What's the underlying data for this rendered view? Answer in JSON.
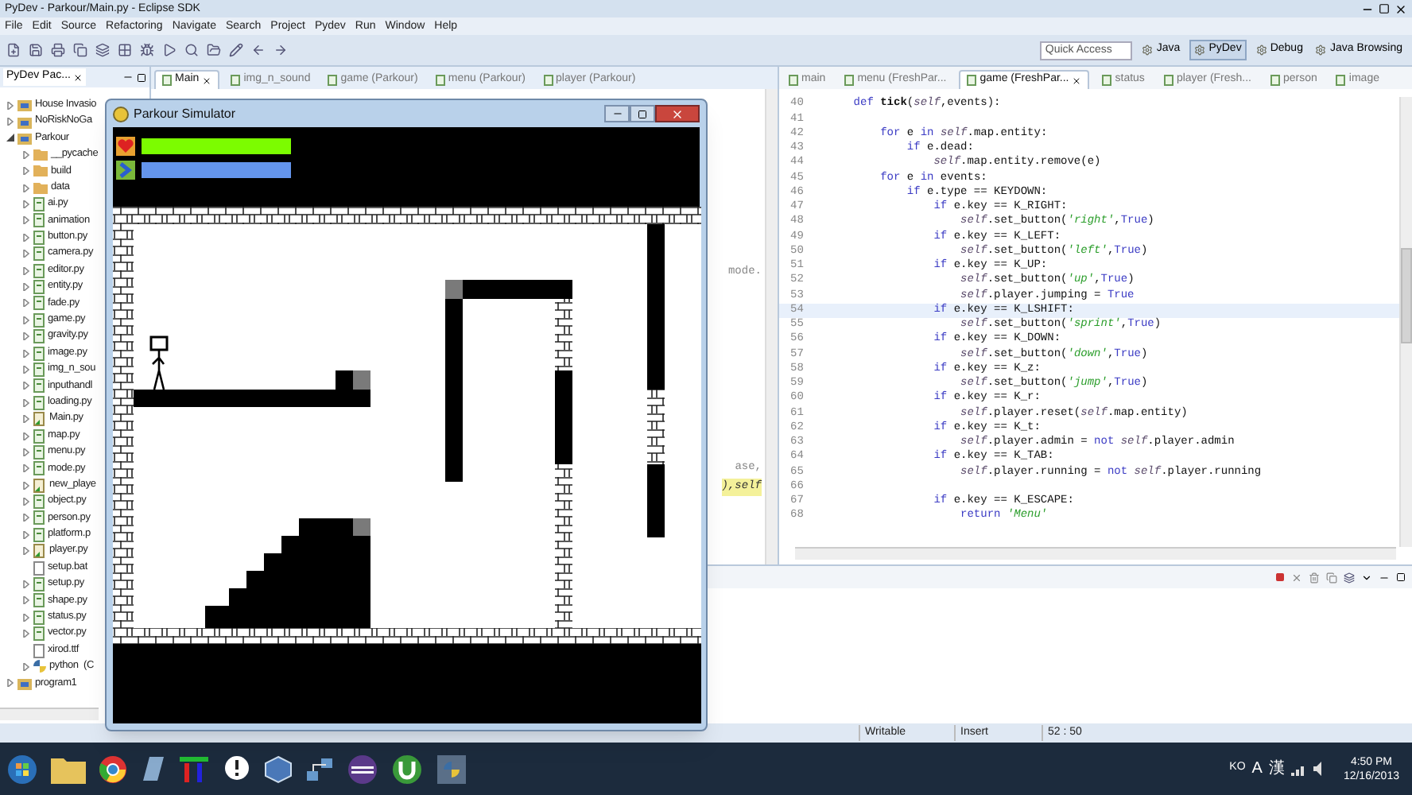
{
  "window": {
    "title": "PyDev - Parkour/Main.py - Eclipse SDK"
  },
  "menu_bar": [
    "File",
    "Edit",
    "Source",
    "Refactoring",
    "Navigate",
    "Search",
    "Project",
    "Pydev",
    "Run",
    "Window",
    "Help"
  ],
  "toolbar": {
    "quick_access": {
      "placeholder": "Quick Access"
    },
    "perspectives": [
      {
        "label": "Java",
        "selected": false
      },
      {
        "label": "PyDev",
        "selected": true
      },
      {
        "label": "Debug",
        "selected": false
      },
      {
        "label": "Java Browsing",
        "selected": false
      }
    ]
  },
  "package_explorer": {
    "title": "PyDev Pac...",
    "tree": [
      {
        "label": "House Invasio",
        "kind": "project",
        "expanded": false
      },
      {
        "label": "NoRiskNoGa",
        "kind": "project",
        "expanded": false
      },
      {
        "label": "Parkour",
        "kind": "project",
        "expanded": true,
        "children": [
          {
            "label": "__pycache",
            "kind": "folder",
            "expanded": false
          },
          {
            "label": "build",
            "kind": "folder",
            "expanded": false
          },
          {
            "label": "data",
            "kind": "folder",
            "expanded": false
          },
          {
            "label": "ai.py",
            "kind": "py",
            "expanded": false
          },
          {
            "label": "animation",
            "kind": "py",
            "expanded": false
          },
          {
            "label": "button.py",
            "kind": "py",
            "expanded": false
          },
          {
            "label": "camera.py",
            "kind": "py",
            "expanded": false
          },
          {
            "label": "editor.py",
            "kind": "py",
            "expanded": false
          },
          {
            "label": "entity.py",
            "kind": "py",
            "expanded": false
          },
          {
            "label": "fade.py",
            "kind": "py",
            "expanded": false
          },
          {
            "label": "game.py",
            "kind": "py",
            "expanded": false
          },
          {
            "label": "gravity.py",
            "kind": "py",
            "expanded": false
          },
          {
            "label": "image.py",
            "kind": "py",
            "expanded": false
          },
          {
            "label": "img_n_sou",
            "kind": "py",
            "expanded": false
          },
          {
            "label": "inputhandl",
            "kind": "py",
            "expanded": false
          },
          {
            "label": "loading.py",
            "kind": "py",
            "expanded": false
          },
          {
            "label": "Main.py",
            "kind": "py-main",
            "expanded": false
          },
          {
            "label": "map.py",
            "kind": "py",
            "expanded": false
          },
          {
            "label": "menu.py",
            "kind": "py",
            "expanded": false
          },
          {
            "label": "mode.py",
            "kind": "py",
            "expanded": false
          },
          {
            "label": "new_playe",
            "kind": "py-main",
            "expanded": false
          },
          {
            "label": "object.py",
            "kind": "py",
            "expanded": false
          },
          {
            "label": "person.py",
            "kind": "py",
            "expanded": false
          },
          {
            "label": "platform.p",
            "kind": "py",
            "expanded": false
          },
          {
            "label": "player.py",
            "kind": "py-main",
            "expanded": false
          },
          {
            "label": "setup.bat",
            "kind": "file"
          },
          {
            "label": "setup.py",
            "kind": "py",
            "expanded": false
          },
          {
            "label": "shape.py",
            "kind": "py",
            "expanded": false
          },
          {
            "label": "status.py",
            "kind": "py",
            "expanded": false
          },
          {
            "label": "vector.py",
            "kind": "py",
            "expanded": false
          },
          {
            "label": "xirod.ttf",
            "kind": "file"
          },
          {
            "label": "python  (C",
            "kind": "lib",
            "expanded": false
          }
        ]
      },
      {
        "label": "program1",
        "kind": "project",
        "expanded": false
      }
    ]
  },
  "middle_editor": {
    "tabs": [
      {
        "label": "Main",
        "selected": true
      },
      {
        "label": "img_n_sound",
        "selected": false
      },
      {
        "label": "game (Parkour)",
        "selected": false
      },
      {
        "label": "menu (Parkour)",
        "selected": false
      },
      {
        "label": "player (Parkour)",
        "selected": false
      }
    ],
    "fragments": [
      "mode.",
      "ase,",
      "),self"
    ]
  },
  "right_editor": {
    "tabs": [
      {
        "label": "main",
        "selected": false
      },
      {
        "label": "menu (FreshPar...",
        "selected": false
      },
      {
        "label": "game (FreshPar...",
        "selected": true
      },
      {
        "label": "status",
        "selected": false
      },
      {
        "label": "player (Fresh...",
        "selected": false
      },
      {
        "label": "person",
        "selected": false
      },
      {
        "label": "image",
        "selected": false
      }
    ],
    "lines": [
      {
        "number": "40",
        "selected": false,
        "tokens": [
          {
            "kind": "keyword",
            "text": "    def "
          },
          {
            "kind": "name",
            "text": "tick"
          },
          {
            "kind": "plain",
            "text": "("
          },
          {
            "kind": "self",
            "text": "self"
          },
          {
            "kind": "plain",
            "text": ",events):"
          }
        ]
      },
      {
        "number": "41",
        "selected": false
      },
      {
        "number": "42",
        "selected": false,
        "tokens": [
          {
            "kind": "keyword",
            "text": "        for"
          },
          {
            "kind": "plain",
            "text": " e "
          },
          {
            "kind": "keyword",
            "text": "in "
          },
          {
            "kind": "self",
            "text": "self"
          },
          {
            "kind": "plain",
            "text": ".map.entity:"
          }
        ]
      },
      {
        "number": "43",
        "selected": false,
        "tokens": [
          {
            "kind": "keyword",
            "text": "            if"
          },
          {
            "kind": "plain",
            "text": " e.dead:"
          }
        ]
      },
      {
        "number": "44",
        "selected": false,
        "tokens": [
          {
            "kind": "self",
            "text": "                self"
          },
          {
            "kind": "plain",
            "text": ".map.entity.remove(e)"
          }
        ]
      },
      {
        "number": "45",
        "selected": false,
        "tokens": [
          {
            "kind": "keyword",
            "text": "        for"
          },
          {
            "kind": "plain",
            "text": " e "
          },
          {
            "kind": "keyword",
            "text": "in"
          },
          {
            "kind": "plain",
            "text": " events:"
          }
        ]
      },
      {
        "number": "46",
        "selected": false,
        "tokens": [
          {
            "kind": "keyword",
            "text": "            if"
          },
          {
            "kind": "plain",
            "text": " e.type == KEYDOWN:"
          }
        ]
      },
      {
        "number": "47",
        "selected": false,
        "tokens": [
          {
            "kind": "keyword",
            "text": "                if"
          },
          {
            "kind": "plain",
            "text": " e.key == K_RIGHT:"
          }
        ]
      },
      {
        "number": "48",
        "selected": false,
        "tokens": [
          {
            "kind": "self",
            "text": "                    self"
          },
          {
            "kind": "plain",
            "text": ".set_button("
          },
          {
            "kind": "string",
            "text": "'right'"
          },
          {
            "kind": "plain",
            "text": ","
          },
          {
            "kind": "constant",
            "text": "True"
          },
          {
            "kind": "plain",
            "text": ")"
          }
        ]
      },
      {
        "number": "49",
        "selected": false,
        "tokens": [
          {
            "kind": "keyword",
            "text": "                if"
          },
          {
            "kind": "plain",
            "text": " e.key == K_LEFT:"
          }
        ]
      },
      {
        "number": "50",
        "selected": false,
        "tokens": [
          {
            "kind": "self",
            "text": "                    self"
          },
          {
            "kind": "plain",
            "text": ".set_button("
          },
          {
            "kind": "string",
            "text": "'left'"
          },
          {
            "kind": "plain",
            "text": ","
          },
          {
            "kind": "constant",
            "text": "True"
          },
          {
            "kind": "plain",
            "text": ")"
          }
        ]
      },
      {
        "number": "51",
        "selected": false,
        "tokens": [
          {
            "kind": "keyword",
            "text": "                if"
          },
          {
            "kind": "plain",
            "text": " e.key == K_UP:"
          }
        ]
      },
      {
        "number": "52",
        "selected": false,
        "tokens": [
          {
            "kind": "self",
            "text": "                    self"
          },
          {
            "kind": "plain",
            "text": ".set_button("
          },
          {
            "kind": "string",
            "text": "'up'"
          },
          {
            "kind": "plain",
            "text": ","
          },
          {
            "kind": "constant",
            "text": "True"
          },
          {
            "kind": "plain",
            "text": ")"
          }
        ]
      },
      {
        "number": "53",
        "selected": false,
        "tokens": [
          {
            "kind": "self",
            "text": "                    self"
          },
          {
            "kind": "plain",
            "text": ".player.jumping = "
          },
          {
            "kind": "constant",
            "text": "True"
          }
        ]
      },
      {
        "number": "54",
        "selected": true,
        "tokens": [
          {
            "kind": "keyword",
            "text": "                if"
          },
          {
            "kind": "plain",
            "text": " e.key == K_LSHIFT:"
          }
        ]
      },
      {
        "number": "55",
        "selected": false,
        "tokens": [
          {
            "kind": "self",
            "text": "                    self"
          },
          {
            "kind": "plain",
            "text": ".set_button("
          },
          {
            "kind": "string",
            "text": "'sprint'"
          },
          {
            "kind": "plain",
            "text": ","
          },
          {
            "kind": "constant",
            "text": "True"
          },
          {
            "kind": "plain",
            "text": ")"
          }
        ]
      },
      {
        "number": "56",
        "selected": false,
        "tokens": [
          {
            "kind": "keyword",
            "text": "                if"
          },
          {
            "kind": "plain",
            "text": " e.key == K_DOWN:"
          }
        ]
      },
      {
        "number": "57",
        "selected": false,
        "tokens": [
          {
            "kind": "self",
            "text": "                    self"
          },
          {
            "kind": "plain",
            "text": ".set_button("
          },
          {
            "kind": "string",
            "text": "'down'"
          },
          {
            "kind": "plain",
            "text": ","
          },
          {
            "kind": "constant",
            "text": "True"
          },
          {
            "kind": "plain",
            "text": ")"
          }
        ]
      },
      {
        "number": "58",
        "selected": false,
        "tokens": [
          {
            "kind": "keyword",
            "text": "                if"
          },
          {
            "kind": "plain",
            "text": " e.key == K_z:"
          }
        ]
      },
      {
        "number": "59",
        "selected": false,
        "tokens": [
          {
            "kind": "self",
            "text": "                    self"
          },
          {
            "kind": "plain",
            "text": ".set_button("
          },
          {
            "kind": "string",
            "text": "'jump'"
          },
          {
            "kind": "plain",
            "text": ","
          },
          {
            "kind": "constant",
            "text": "True"
          },
          {
            "kind": "plain",
            "text": ")"
          }
        ]
      },
      {
        "number": "60",
        "selected": false,
        "tokens": [
          {
            "kind": "keyword",
            "text": "                if"
          },
          {
            "kind": "plain",
            "text": " e.key == K_r:"
          }
        ]
      },
      {
        "number": "61",
        "selected": false,
        "tokens": [
          {
            "kind": "self",
            "text": "                    self"
          },
          {
            "kind": "plain",
            "text": ".player.reset("
          },
          {
            "kind": "self",
            "text": "self"
          },
          {
            "kind": "plain",
            "text": ".map.entity)"
          }
        ]
      },
      {
        "number": "62",
        "selected": false,
        "tokens": [
          {
            "kind": "keyword",
            "text": "                if"
          },
          {
            "kind": "plain",
            "text": " e.key == K_t:"
          }
        ]
      },
      {
        "number": "63",
        "selected": false,
        "tokens": [
          {
            "kind": "self",
            "text": "                    self"
          },
          {
            "kind": "plain",
            "text": ".player.admin = "
          },
          {
            "kind": "keyword",
            "text": "not "
          },
          {
            "kind": "self",
            "text": "self"
          },
          {
            "kind": "plain",
            "text": ".player.admin"
          }
        ]
      },
      {
        "number": "64",
        "selected": false,
        "tokens": [
          {
            "kind": "keyword",
            "text": "                if"
          },
          {
            "kind": "plain",
            "text": " e.key == K_TAB:"
          }
        ]
      },
      {
        "number": "65",
        "selected": false,
        "tokens": [
          {
            "kind": "self",
            "text": "                    self"
          },
          {
            "kind": "plain",
            "text": ".player.running = "
          },
          {
            "kind": "keyword",
            "text": "not "
          },
          {
            "kind": "self",
            "text": "self"
          },
          {
            "kind": "plain",
            "text": ".player.running"
          }
        ]
      },
      {
        "number": "66",
        "selected": false
      },
      {
        "number": "67",
        "selected": false,
        "tokens": [
          {
            "kind": "keyword",
            "text": "                if"
          },
          {
            "kind": "plain",
            "text": " e.key == K_ESCAPE:"
          }
        ]
      },
      {
        "number": "68",
        "selected": false,
        "tokens": [
          {
            "kind": "keyword",
            "text": "                    return "
          },
          {
            "kind": "string",
            "text": "'Menu'"
          }
        ]
      }
    ]
  },
  "game_window": {
    "title": "Parkour Simulator",
    "health": {
      "level": 1
    },
    "stamina": {
      "level": 1
    }
  },
  "status_bar": [
    "Writable",
    "Insert",
    "52 : 50"
  ],
  "taskbar": {
    "tray": {
      "language": "KO",
      "ime": [
        "A",
        "漢"
      ],
      "time": "4:50 PM",
      "date": "12/16/2013"
    }
  }
}
